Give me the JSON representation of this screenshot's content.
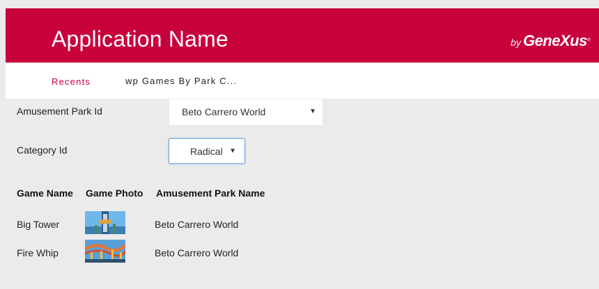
{
  "header": {
    "app_title": "Application Name",
    "brand_by": "by",
    "brand_name": "GeneXus",
    "brand_reg": "®",
    "background_color": "#c8003c"
  },
  "breadcrumb": {
    "recents_label": "Recents",
    "current_label": "wp Games By Park C..."
  },
  "filters": {
    "park_label": "Amusement Park Id",
    "park_value": "Beto Carrero World",
    "category_label": "Category Id",
    "category_value": "Radical"
  },
  "grid": {
    "columns": [
      "Game Name",
      "Game Photo",
      "Amusement Park Name"
    ],
    "rows": [
      {
        "game_name": "Big Tower",
        "photo": "big-tower-photo",
        "park_name": "Beto Carrero World"
      },
      {
        "game_name": "Fire Whip",
        "photo": "fire-whip-photo",
        "park_name": "Beto Carrero World"
      }
    ]
  }
}
